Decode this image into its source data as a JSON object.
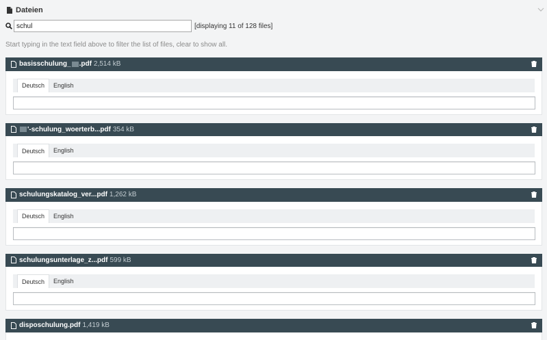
{
  "panel": {
    "title": "Dateien",
    "icon": "file-icon"
  },
  "search": {
    "value": "schul",
    "count_text": "[displaying 11 of 128 files]"
  },
  "hint": "Start typing in the text field above to filter the list of files, clear to show all.",
  "tabs": {
    "de": "Deutsch",
    "en": "English"
  },
  "files": [
    {
      "name_prefix": "basisschulung_",
      "name_suffix": ".pdf",
      "redacted": "middle",
      "size": "2,514 kB"
    },
    {
      "name_prefix": "",
      "name_suffix": "'-schulung_woerterb...pdf",
      "redacted": "start",
      "size": "354 kB"
    },
    {
      "name_prefix": "schulungskatalog_ver...pdf",
      "name_suffix": "",
      "redacted": "none",
      "size": "1,262 kB"
    },
    {
      "name_prefix": "schulungsunterlage_z...pdf",
      "name_suffix": "",
      "redacted": "none",
      "size": "599 kB"
    },
    {
      "name_prefix": "disposchulung.pdf",
      "name_suffix": "",
      "redacted": "none",
      "size": "1,419 kB"
    }
  ],
  "colors": {
    "file_header_bg": "#384a53",
    "page_bg": "#f3f4f5"
  }
}
